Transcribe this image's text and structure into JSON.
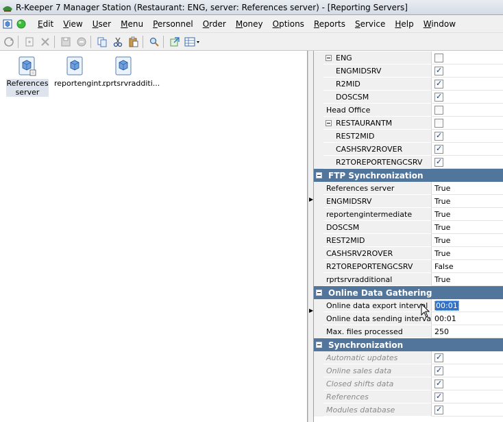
{
  "window": {
    "title": "R-Keeper 7 Manager Station (Restaurant: ENG, server: References server) - [Reporting Servers]"
  },
  "menubar": {
    "items": [
      {
        "label": "Edit",
        "u": "E",
        "rest": "dit"
      },
      {
        "label": "View",
        "u": "V",
        "rest": "iew"
      },
      {
        "label": "User",
        "u": "U",
        "rest": "ser"
      },
      {
        "label": "Menu",
        "u": "M",
        "rest": "enu"
      },
      {
        "label": "Personnel",
        "u": "P",
        "rest": "ersonnel"
      },
      {
        "label": "Order",
        "u": "O",
        "rest": "rder"
      },
      {
        "label": "Money",
        "u": "M",
        "rest": "oney"
      },
      {
        "label": "Options",
        "u": "O",
        "rest": "ptions"
      },
      {
        "label": "Reports",
        "u": "R",
        "rest": "eports"
      },
      {
        "label": "Service",
        "u": "S",
        "rest": "ervice"
      },
      {
        "label": "Help",
        "u": "H",
        "rest": "elp"
      },
      {
        "label": "Window",
        "u": "W",
        "rest": "indow"
      }
    ]
  },
  "toolbar": {
    "icons": [
      "refresh-icon",
      "new-icon",
      "delete-icon",
      "save-icon",
      "cancel-icon",
      "copy-icon",
      "cut-icon",
      "paste-icon",
      "find-icon",
      "export-icon",
      "view-mode-icon"
    ]
  },
  "objects": [
    {
      "label": "References server",
      "line1": "References",
      "line2": "server",
      "selected": true
    },
    {
      "label": "reportengint...",
      "line1": "reportengint...",
      "line2": "",
      "selected": false
    },
    {
      "label": "rprtsrvradditi...",
      "line1": "rprtsrvradditi...",
      "line2": "",
      "selected": false
    }
  ],
  "properties": {
    "tree_rows": [
      {
        "name": "ENG",
        "checked": false,
        "expander": true,
        "indent": false
      },
      {
        "name": "ENGMIDSRV",
        "checked": true,
        "expander": false,
        "indent": true
      },
      {
        "name": "R2MID",
        "checked": true,
        "expander": false,
        "indent": true
      },
      {
        "name": "DOSCSM",
        "checked": true,
        "expander": false,
        "indent": true
      },
      {
        "name": "Head Office",
        "checked": false,
        "expander": false,
        "indent": false
      },
      {
        "name": "RESTAURANTM",
        "checked": false,
        "expander": true,
        "indent": false
      },
      {
        "name": "REST2MID",
        "checked": true,
        "expander": false,
        "indent": true
      },
      {
        "name": "CASHSRV2ROVER",
        "checked": true,
        "expander": false,
        "indent": true
      },
      {
        "name": "R2TOREPORTENGCSRV",
        "checked": true,
        "expander": false,
        "indent": true
      }
    ],
    "ftp": {
      "header": "FTP Synchronization",
      "rows": [
        {
          "name": "References server",
          "value": "True"
        },
        {
          "name": "ENGMIDSRV",
          "value": "True"
        },
        {
          "name": "reportengintermediate",
          "value": "True"
        },
        {
          "name": "DOSCSM",
          "value": "True"
        },
        {
          "name": "REST2MID",
          "value": "True"
        },
        {
          "name": "CASHSRV2ROVER",
          "value": "True"
        },
        {
          "name": "R2TOREPORTENGCSRV",
          "value": "False"
        },
        {
          "name": "rprtsrvradditional",
          "value": "True"
        }
      ]
    },
    "online": {
      "header": "Online Data Gathering",
      "rows": [
        {
          "name": "Online data export interval",
          "value": "00:01",
          "editing": true
        },
        {
          "name": "Online data sending interval",
          "value": "00:01",
          "editing": false
        },
        {
          "name": "Max. files processed",
          "value": "250",
          "editing": false
        }
      ]
    },
    "sync": {
      "header": "Synchronization",
      "rows": [
        {
          "name": "Automatic updates",
          "checked": true
        },
        {
          "name": "Online sales data",
          "checked": true
        },
        {
          "name": "Closed shifts data",
          "checked": true
        },
        {
          "name": "References",
          "checked": true
        },
        {
          "name": "Modules database",
          "checked": true
        }
      ]
    }
  }
}
